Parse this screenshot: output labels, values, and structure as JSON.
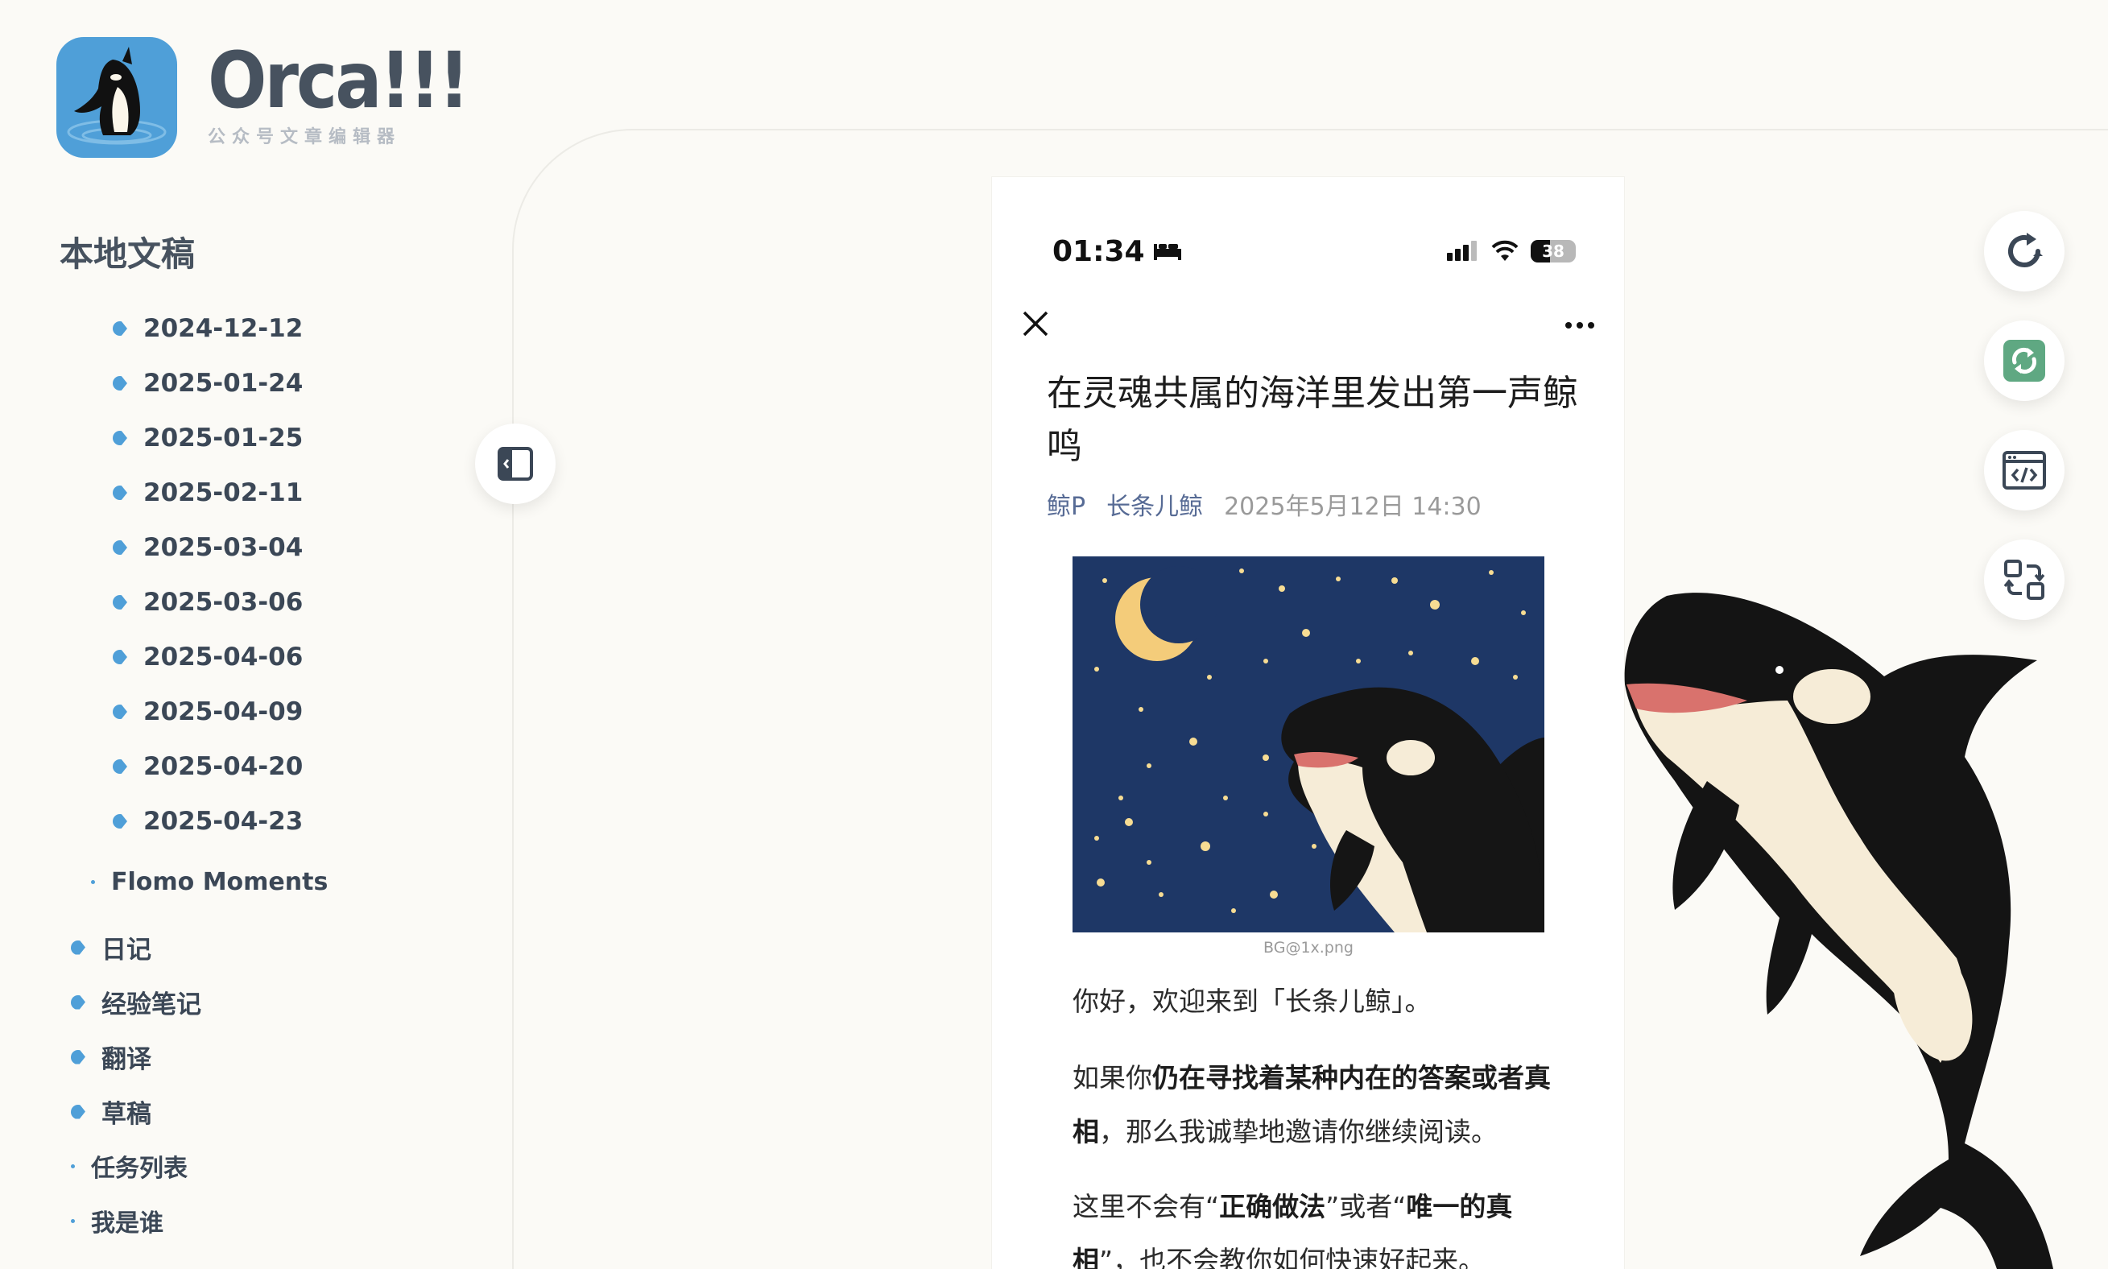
{
  "brand": {
    "name": "Orca!!!",
    "subtitle": "公众号文章编辑器"
  },
  "sidebar": {
    "section_title": "本地文稿",
    "dated_items": [
      "2024-12-12",
      "2025-01-24",
      "2025-01-25",
      "2025-02-11",
      "2025-03-04",
      "2025-03-06",
      "2025-04-06",
      "2025-04-09",
      "2025-04-20",
      "2025-04-23"
    ],
    "sub_file": "Flomo Moments",
    "folders": [
      "日记",
      "经验笔记",
      "翻译",
      "草稿"
    ],
    "files": [
      "任务列表",
      "我是谁"
    ]
  },
  "phone": {
    "time": "01:34",
    "battery": "38",
    "article_title": "在灵魂共属的海洋里发出第一声鲸鸣",
    "account": "鲸P",
    "author": "长条儿鲸",
    "date": "2025年5月12日 14:30",
    "image_caption": "BG@1x.png",
    "para1": "你好，欢迎来到「长条儿鲸」。",
    "para2_a": "如果你",
    "para2_b": "仍在寻找着某种内在的答案或者真相",
    "para2_c": "，那么我诚挚地邀请你继续阅读。",
    "para3_a": "这里不会有“",
    "para3_b": "正确做法",
    "para3_c": "”或者“",
    "para3_d": "唯一的真相",
    "para3_e": "”，也不会教你如何快速好起来。"
  },
  "tools": [
    "refresh-icon",
    "wechat-sync-icon",
    "code-view-icon",
    "layout-switch-icon"
  ],
  "colors": {
    "accent": "#4f9fd8",
    "background": "#fbfaf6",
    "link": "#576b95",
    "sync_green": "#5fa882"
  }
}
